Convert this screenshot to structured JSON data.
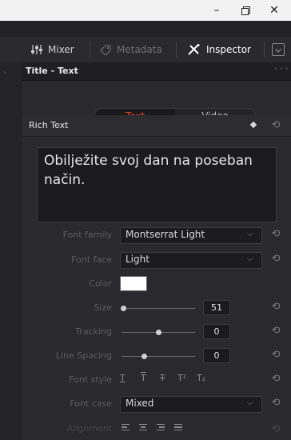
{
  "window": {
    "minimize": "–",
    "restore": "ᗜ",
    "close": "✕"
  },
  "toolbar": {
    "mixer_label": "Mixer",
    "metadata_label": "Metadata",
    "inspector_label": "Inspector"
  },
  "panel": {
    "title": "Title - Text",
    "tabs": [
      {
        "label": "Text",
        "active": true
      },
      {
        "label": "Video",
        "active": false
      }
    ],
    "rich_text_label": "Rich Text",
    "editor_text": "Obilježite svoj dan na poseban način."
  },
  "properties": {
    "font_family": {
      "label": "Font family",
      "value": "Montserrat Light"
    },
    "font_face": {
      "label": "Font face",
      "value": "Light"
    },
    "color": {
      "label": "Color",
      "value": "#ffffff"
    },
    "size": {
      "label": "Size",
      "value": "51",
      "level": 0.02
    },
    "tracking": {
      "label": "Tracking",
      "value": "0",
      "level": 0.5
    },
    "line_spacing": {
      "label": "Line Spacing",
      "value": "0",
      "level": 0.3
    },
    "font_style": {
      "label": "Font style",
      "options": [
        "T",
        "T",
        "T",
        "T²",
        "T₂"
      ]
    },
    "font_case": {
      "label": "Font case",
      "value": "Mixed"
    },
    "alignment": {
      "label": "Alignment"
    }
  },
  "colors": {
    "accent": "#e0402f",
    "panel_bg": "#2a2a2e",
    "editor_bg": "#1b1b1d"
  }
}
